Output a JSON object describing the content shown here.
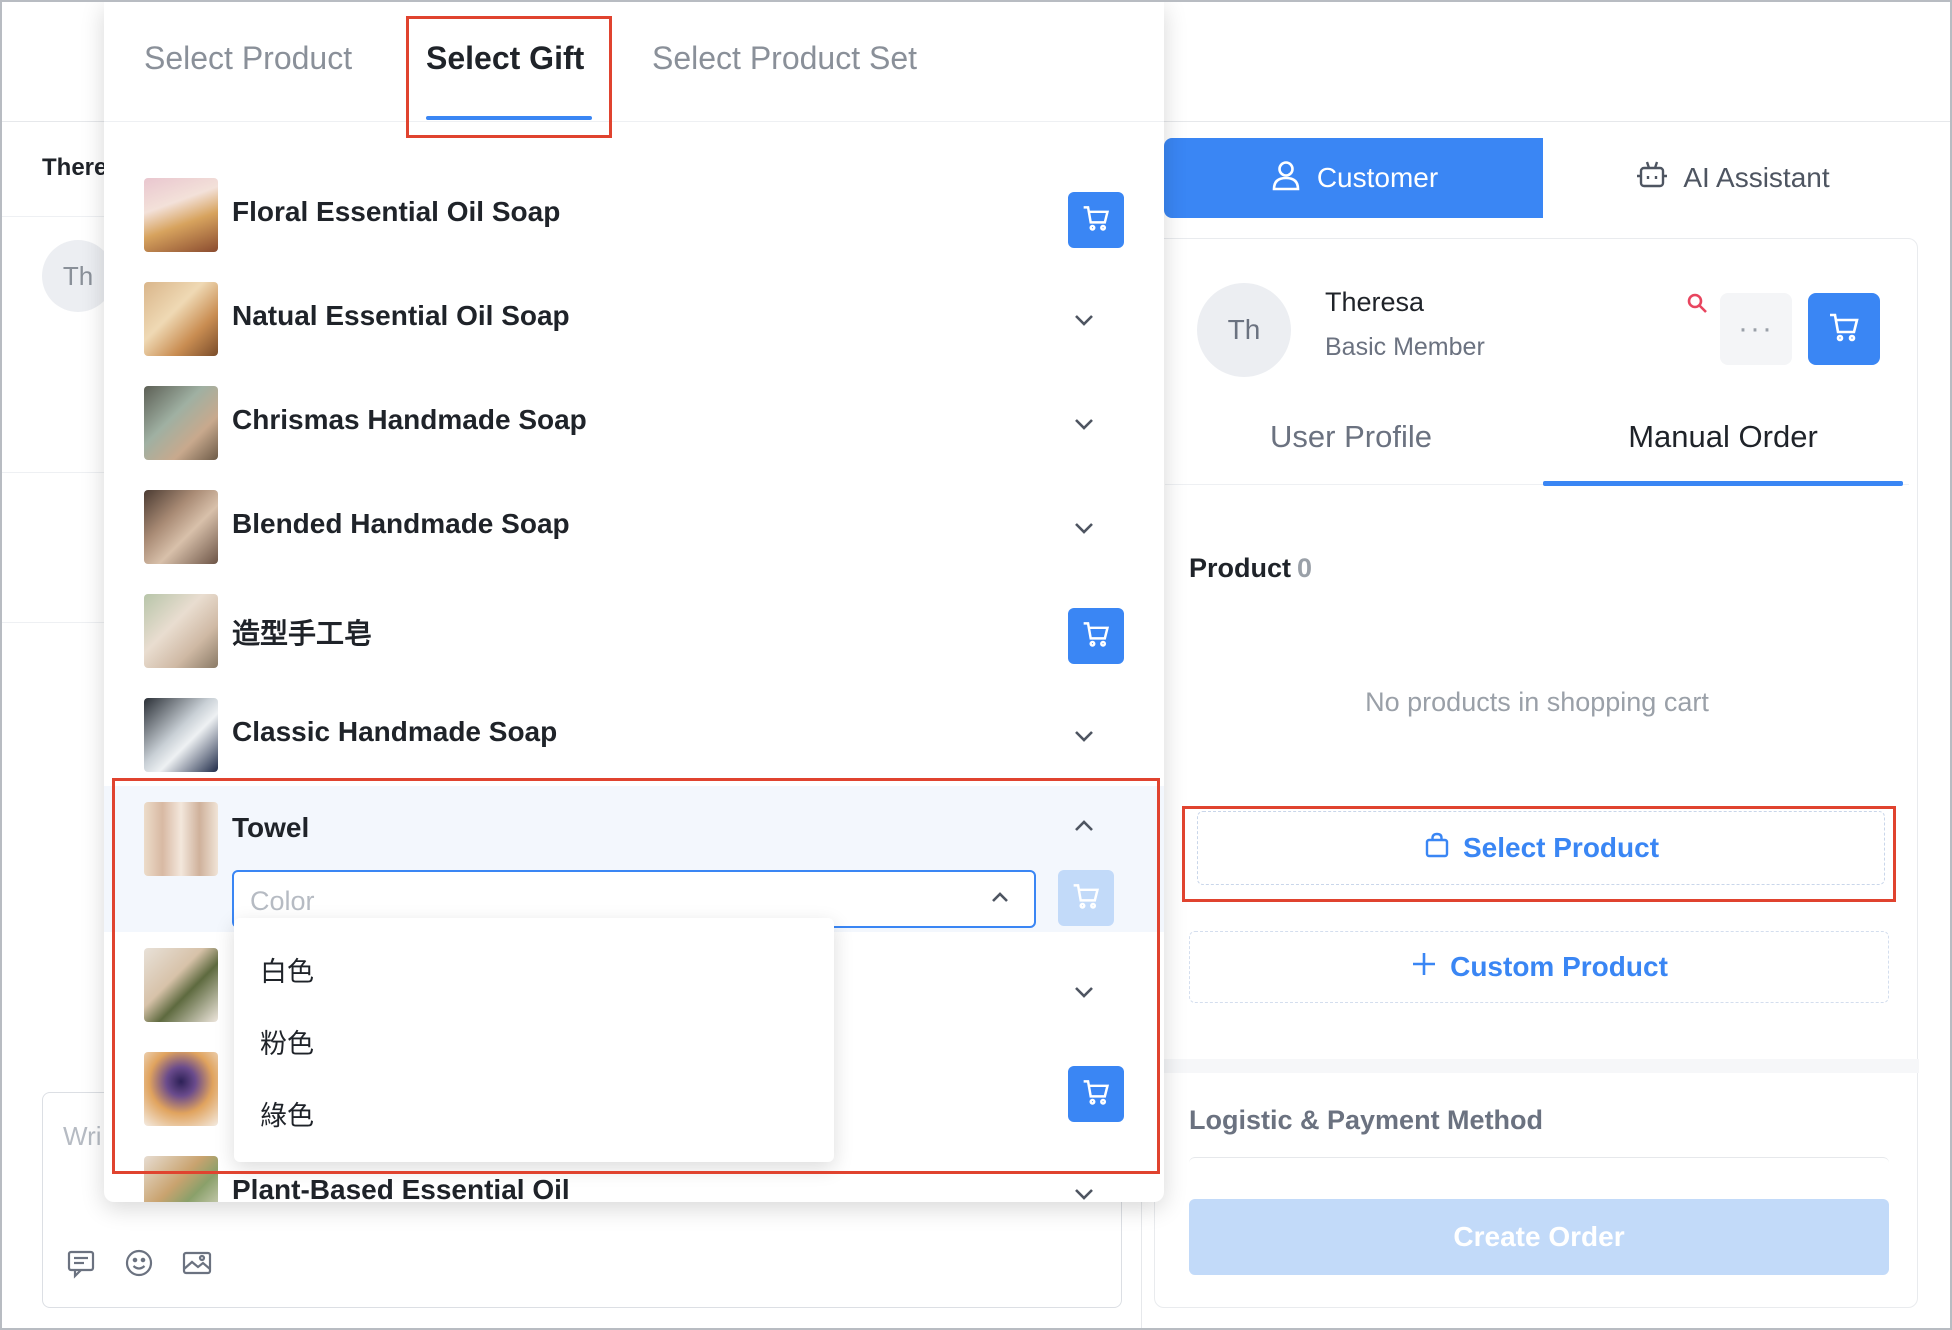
{
  "picker": {
    "tabs": [
      {
        "label": "Select Product"
      },
      {
        "label": "Select Gift"
      },
      {
        "label": "Select Product Set"
      }
    ],
    "items": [
      {
        "name": "Floral Essential Oil Soap",
        "action": "cart"
      },
      {
        "name": "Natual Essential Oil Soap",
        "action": "expand"
      },
      {
        "name": "Chrismas Handmade Soap",
        "action": "expand"
      },
      {
        "name": "Blended Handmade Soap",
        "action": "expand"
      },
      {
        "name": "造型手工皂",
        "action": "cart"
      },
      {
        "name": "Classic Handmade Soap",
        "action": "expand"
      },
      {
        "name": "Towel",
        "action": "collapse"
      },
      {
        "name": "",
        "action": "expand"
      },
      {
        "name": "",
        "action": "cart"
      },
      {
        "name": "Plant-Based Essential Oil",
        "action": "expand"
      }
    ],
    "color_select": {
      "placeholder": "Color",
      "options": [
        "白色",
        "粉色",
        "綠色"
      ]
    }
  },
  "chat": {
    "contact_name": "There",
    "avatar_initials": "Th",
    "composer_placeholder": "Wri nev"
  },
  "customer_panel": {
    "tabs": [
      {
        "label": "Customer",
        "icon": "user-icon"
      },
      {
        "label": "AI Assistant",
        "icon": "robot-icon"
      }
    ],
    "customer": {
      "initials": "Th",
      "name": "Theresa",
      "level": "Basic Member"
    },
    "sub_tabs": [
      "User Profile",
      "Manual Order"
    ],
    "product_label": "Product",
    "product_count": "0",
    "empty_text": "No products in shopping cart",
    "select_product_label": "Select Product",
    "custom_product_label": "Custom Product",
    "logistic_label": "Logistic & Payment Method",
    "create_order_label": "Create Order"
  },
  "colors": {
    "accent": "#3a86f4",
    "accent_disabled": "#c2daf9",
    "annotation": "#e0432f"
  }
}
